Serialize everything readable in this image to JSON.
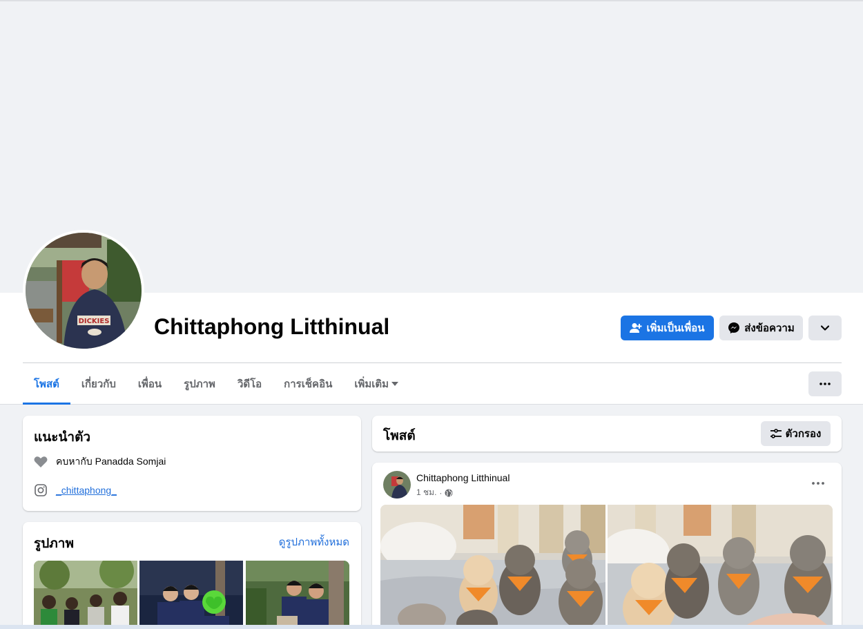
{
  "profile": {
    "name": "Chittaphong Litthinual"
  },
  "actions": {
    "add_friend": "เพิ่มเป็นเพื่อน",
    "message": "ส่งข้อความ"
  },
  "tabs": [
    {
      "label": "โพสต์",
      "active": true
    },
    {
      "label": "เกี่ยวกับ",
      "active": false
    },
    {
      "label": "เพื่อน",
      "active": false
    },
    {
      "label": "รูปภาพ",
      "active": false
    },
    {
      "label": "วิดีโอ",
      "active": false
    },
    {
      "label": "การเช็คอิน",
      "active": false
    },
    {
      "label": "เพิ่มเติม",
      "active": false
    }
  ],
  "intro": {
    "title": "แนะนำตัว",
    "relationship_prefix": "คบหากับ",
    "relationship_name": "Panadda Somjai",
    "instagram": "_chittaphong_"
  },
  "photos": {
    "title": "รูปภาพ",
    "see_all": "ดูรูปภาพทั้งหมด"
  },
  "posts": {
    "title": "โพสต์",
    "filter": "ตัวกรอง"
  },
  "post": {
    "author": "Chittaphong Litthinual",
    "time": "1 ชม.",
    "separator": "·"
  },
  "colors": {
    "brand_blue": "#1b74e4",
    "secondary_button": "#e4e6eb",
    "page_bg": "#f0f2f5"
  }
}
